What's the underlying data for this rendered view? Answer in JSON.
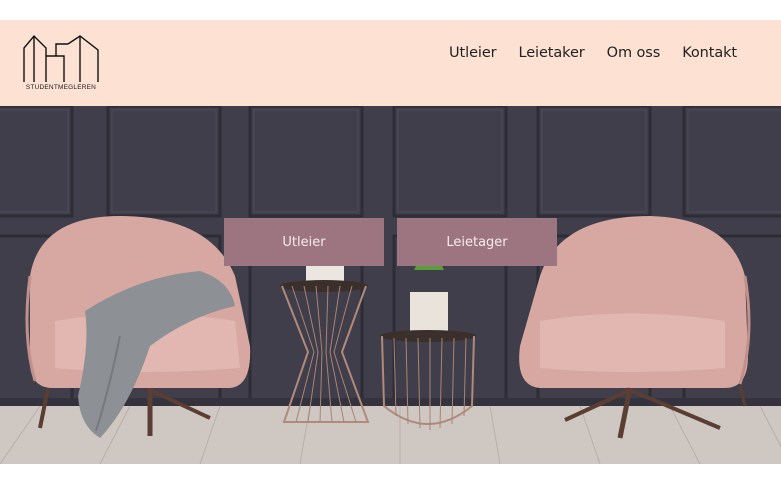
{
  "brand": {
    "name": "STUDENTMEGLEREN",
    "logo_icon": "house-outline-icon"
  },
  "nav": {
    "items": [
      {
        "label": "Utleier"
      },
      {
        "label": "Leietaker"
      },
      {
        "label": "Om oss"
      },
      {
        "label": "Kontakt"
      }
    ]
  },
  "hero": {
    "buttons": [
      {
        "label": "Utleier"
      },
      {
        "label": "Leietager"
      }
    ]
  },
  "colors": {
    "header_bg": "#fde2d4",
    "button_bg": "#9c7581",
    "wall": "#3f3e4a",
    "chair": "#d9a9a3"
  }
}
